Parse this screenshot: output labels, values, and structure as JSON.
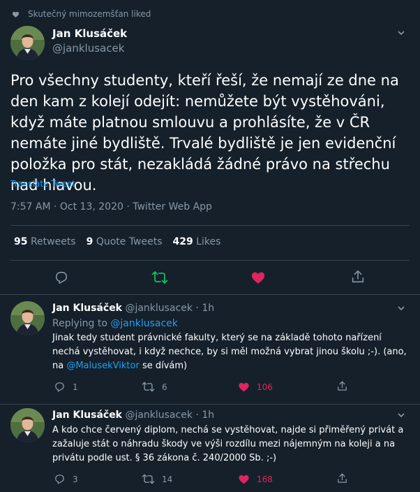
{
  "social_context": {
    "text": "Skutečný mimozemšťan liked",
    "icon": "heart-icon"
  },
  "main_tweet": {
    "author_name": "Jan Klusáček",
    "handle": "@janklusacek",
    "text": "Pro všechny studenty, kteří řeší, že nemají ze dne na den kam z kolejí odejít: nemůžete být vystěhováni, když máte platnou smlouvu a prohlásíte, že v ČR nemáte jiné bydliště. Trvalé bydliště je jen evidenční položka pro stát, nezakládá žádné právo na střechu nad hlavou.",
    "translate": "Translate Tweet",
    "meta": "7:57 AM · Oct 13, 2020 · Twitter Web App",
    "stats": [
      {
        "count": "95",
        "label": "Retweets"
      },
      {
        "count": "9",
        "label": "Quote Tweets"
      },
      {
        "count": "429",
        "label": "Likes"
      }
    ]
  },
  "replies": [
    {
      "author_name": "Jan Klusáček",
      "handle": "@janklusacek",
      "time": "· 1h",
      "replying_prefix": "Replying to ",
      "replying_to": "@janklusacek",
      "text_1": "Jinak tedy student právnické fakulty, který se na základě tohoto nařízení nechá vystěhovat, i když nechce, by si měl možná vybrat jinou školu ;-). (ano, na ",
      "mention": "@MalusekViktor",
      "text_2": " se dívám)",
      "replies_count": "1",
      "retweets_count": "6",
      "likes_count": "106"
    },
    {
      "author_name": "Jan Klusáček",
      "handle": "@janklusacek",
      "time": "· 1h",
      "text": "A kdo chce červený diplom, nechá se vystěhovat, najde si přiměřený privát a zažaluje stát o náhradu škody ve výši rozdílu mezi nájemným na koleji a na privátu podle ust. § 36 zákona č. 240/2000 Sb. ;-)",
      "replies_count": "3",
      "retweets_count": "14",
      "likes_count": "168"
    }
  ],
  "colors": {
    "background": "#15202b",
    "muted": "#8899a6",
    "link": "#1da1f2",
    "like": "#e0245e",
    "retweet": "#17bf63",
    "divider": "#38444d"
  }
}
